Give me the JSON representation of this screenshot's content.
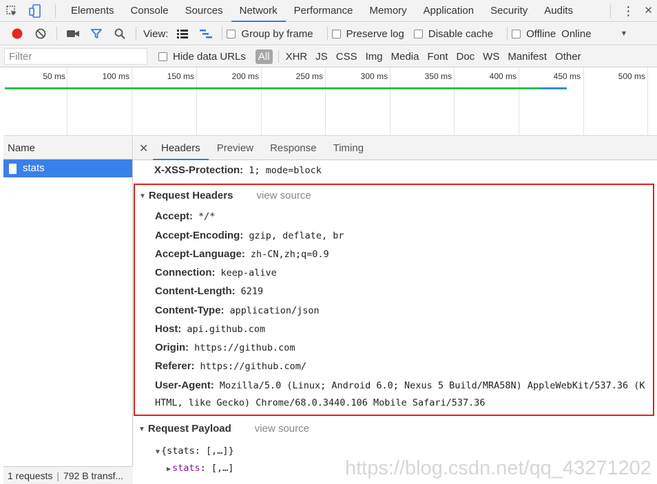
{
  "tabbar": {
    "tabs": [
      "Elements",
      "Console",
      "Sources",
      "Network",
      "Performance",
      "Memory",
      "Application",
      "Security",
      "Audits"
    ],
    "active_tab": "Network",
    "more_glyph": "⋮",
    "close_glyph": "✕"
  },
  "toolbar": {
    "view_label": "View:",
    "group_by_frame": "Group by frame",
    "preserve_log": "Preserve log",
    "disable_cache": "Disable cache",
    "offline": "Offline",
    "throttle_value": "Online",
    "dropdown_glyph": "▼"
  },
  "filterbar": {
    "filter_placeholder": "Filter",
    "hide_data_urls": "Hide data URLs",
    "types": [
      "All",
      "XHR",
      "JS",
      "CSS",
      "Img",
      "Media",
      "Font",
      "Doc",
      "WS",
      "Manifest",
      "Other"
    ]
  },
  "overview": {
    "ticks": [
      "50 ms",
      "100 ms",
      "150 ms",
      "200 ms",
      "250 ms",
      "300 ms",
      "350 ms",
      "400 ms",
      "450 ms",
      "500 ms"
    ]
  },
  "requests": {
    "header": "Name",
    "items": [
      {
        "name": "stats"
      }
    ],
    "status_count": "1 requests",
    "status_transfer": "792 B transf..."
  },
  "detail": {
    "close_glyph": "✕",
    "tabs": [
      "Headers",
      "Preview",
      "Response",
      "Timing"
    ],
    "active_tab": "Headers",
    "top_header": {
      "key": "X-XSS-Protection:",
      "value": "1; mode=block"
    },
    "request_headers": {
      "title": "Request Headers",
      "view_source": "view source",
      "items": [
        {
          "key": "Accept:",
          "value": "*/*"
        },
        {
          "key": "Accept-Encoding:",
          "value": "gzip, deflate, br"
        },
        {
          "key": "Accept-Language:",
          "value": "zh-CN,zh;q=0.9"
        },
        {
          "key": "Connection:",
          "value": "keep-alive"
        },
        {
          "key": "Content-Length:",
          "value": "6219"
        },
        {
          "key": "Content-Type:",
          "value": "application/json"
        },
        {
          "key": "Host:",
          "value": "api.github.com"
        },
        {
          "key": "Origin:",
          "value": "https://github.com"
        },
        {
          "key": "Referer:",
          "value": "https://github.com/"
        },
        {
          "key": "User-Agent:",
          "value": "Mozilla/5.0 (Linux; Android 6.0; Nexus 5 Build/MRA58N) AppleWebKit/537.36 (K"
        }
      ],
      "user_agent_cont": "HTML, like Gecko) Chrome/68.0.3440.106 Mobile Safari/537.36"
    },
    "request_payload": {
      "title": "Request Payload",
      "view_source": "view source",
      "root": "{stats: [,…]}",
      "child_key": "stats",
      "child_value": ": [,…]"
    }
  },
  "watermark": "https://blog.csdn.net/qq_43271202",
  "colors": {
    "accent": "#3879d9",
    "selected_row": "#3a80ea",
    "record": "#e8271c",
    "highlight_box": "#e02020"
  }
}
